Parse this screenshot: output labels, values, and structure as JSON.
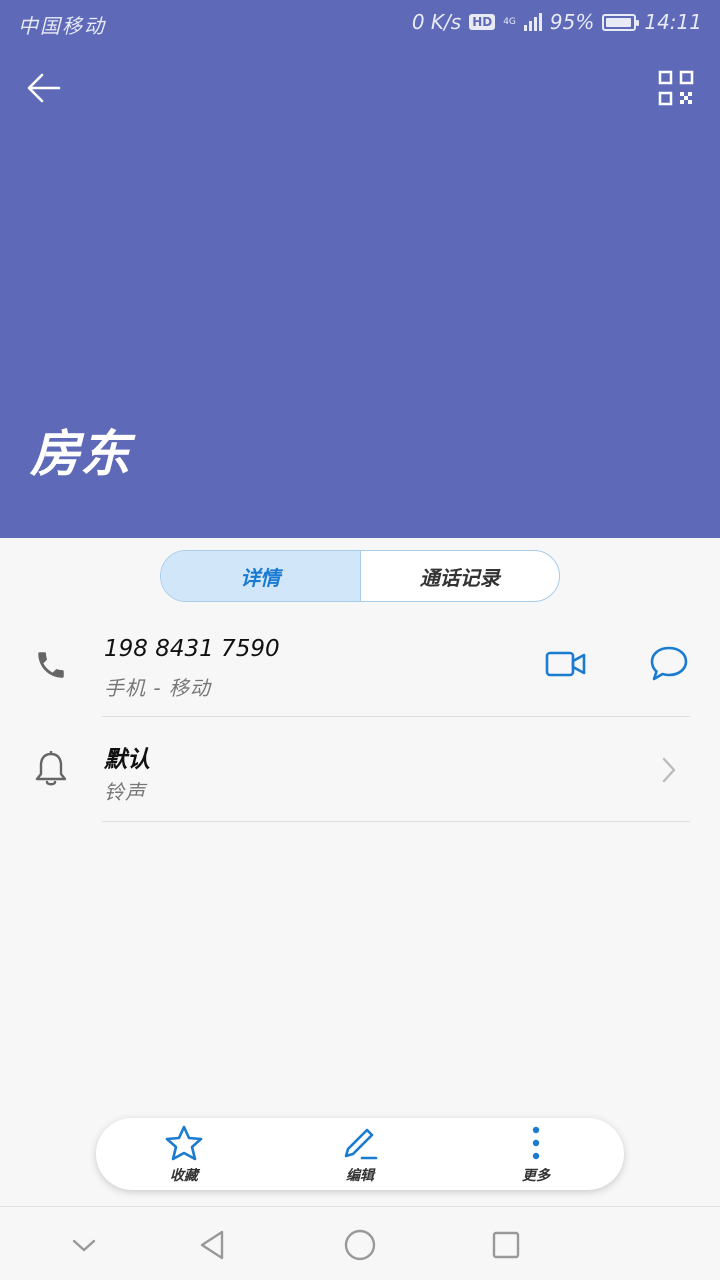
{
  "status_bar": {
    "carrier": "中国移动",
    "speed": "0 K/s",
    "hd": "HD",
    "network": "4G",
    "battery": "95%",
    "battery_level": 0.95,
    "time": "14:11"
  },
  "header": {
    "background_color": "#5e6ab8",
    "back_icon": "arrow-left-icon",
    "qr_icon": "qr-code-icon",
    "contact_name": "房东"
  },
  "tabs": [
    {
      "label": "详情",
      "active": true
    },
    {
      "label": "通话记录",
      "active": false
    }
  ],
  "phone_row": {
    "icon": "phone-icon",
    "number": "198 8431 7590",
    "type": "手机 - 移动",
    "video_icon": "video-call-icon",
    "message_icon": "message-icon",
    "accent_color": "#1a7bd0"
  },
  "ringtone_row": {
    "icon": "bell-icon",
    "value": "默认",
    "label": "铃声",
    "chevron_icon": "chevron-right-icon"
  },
  "bottom_actions": [
    {
      "label": "收藏",
      "icon": "star-icon"
    },
    {
      "label": "编辑",
      "icon": "edit-icon"
    },
    {
      "label": "更多",
      "icon": "more-vertical-icon"
    }
  ],
  "nav_bar": {
    "icons": [
      "chevron-down-icon",
      "back-triangle-icon",
      "home-circle-icon",
      "recents-square-icon"
    ]
  }
}
